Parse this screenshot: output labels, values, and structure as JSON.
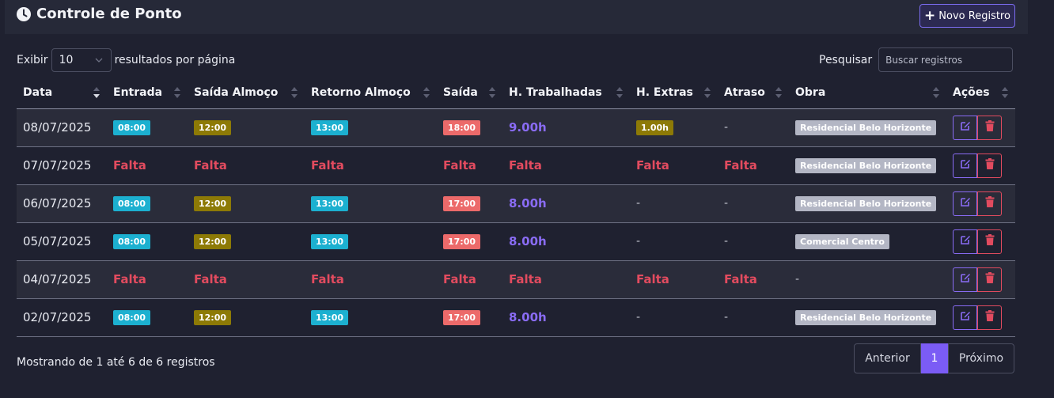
{
  "header": {
    "title": "Controle de Ponto",
    "new_button": "Novo Registro"
  },
  "controls": {
    "show_label": "Exibir",
    "page_size": "10",
    "per_page_label": "resultados por página",
    "search_label": "Pesquisar",
    "search_placeholder": "Buscar registros"
  },
  "columns": [
    "Data",
    "Entrada",
    "Saída Almoço",
    "Retorno Almoço",
    "Saída",
    "H. Trabalhadas",
    "H. Extras",
    "Atraso",
    "Obra",
    "Ações"
  ],
  "rows": [
    {
      "data": "08/07/2025",
      "entrada": "08:00",
      "saida_almoco": "12:00",
      "retorno_almoco": "13:00",
      "saida": "18:00",
      "horas": "9.00h",
      "extras": "1.00h",
      "atraso": "-",
      "obra": "Residencial Belo Horizonte"
    },
    {
      "data": "07/07/2025",
      "entrada": "Falta",
      "saida_almoco": "Falta",
      "retorno_almoco": "Falta",
      "saida": "Falta",
      "horas": "Falta",
      "extras": "Falta",
      "atraso": "Falta",
      "obra": "Residencial Belo Horizonte"
    },
    {
      "data": "06/07/2025",
      "entrada": "08:00",
      "saida_almoco": "12:00",
      "retorno_almoco": "13:00",
      "saida": "17:00",
      "horas": "8.00h",
      "extras": "-",
      "atraso": "-",
      "obra": "Residencial Belo Horizonte"
    },
    {
      "data": "05/07/2025",
      "entrada": "08:00",
      "saida_almoco": "12:00",
      "retorno_almoco": "13:00",
      "saida": "17:00",
      "horas": "8.00h",
      "extras": "-",
      "atraso": "-",
      "obra": "Comercial Centro"
    },
    {
      "data": "04/07/2025",
      "entrada": "Falta",
      "saida_almoco": "Falta",
      "retorno_almoco": "Falta",
      "saida": "Falta",
      "horas": "Falta",
      "extras": "Falta",
      "atraso": "Falta",
      "obra": "-"
    },
    {
      "data": "02/07/2025",
      "entrada": "08:00",
      "saida_almoco": "12:00",
      "retorno_almoco": "13:00",
      "saida": "17:00",
      "horas": "8.00h",
      "extras": "-",
      "atraso": "-",
      "obra": "Residencial Belo Horizonte"
    }
  ],
  "footer": {
    "info": "Mostrando de 1 até 6 de 6 registros",
    "prev": "Anterior",
    "current_page": "1",
    "next": "Próximo"
  },
  "colors": {
    "accent": "#7b5cf5",
    "falta": "#e24b5f",
    "entrada": "#1cb0d0",
    "almoco": "#8d7a06",
    "saida": "#ec6a6a"
  }
}
